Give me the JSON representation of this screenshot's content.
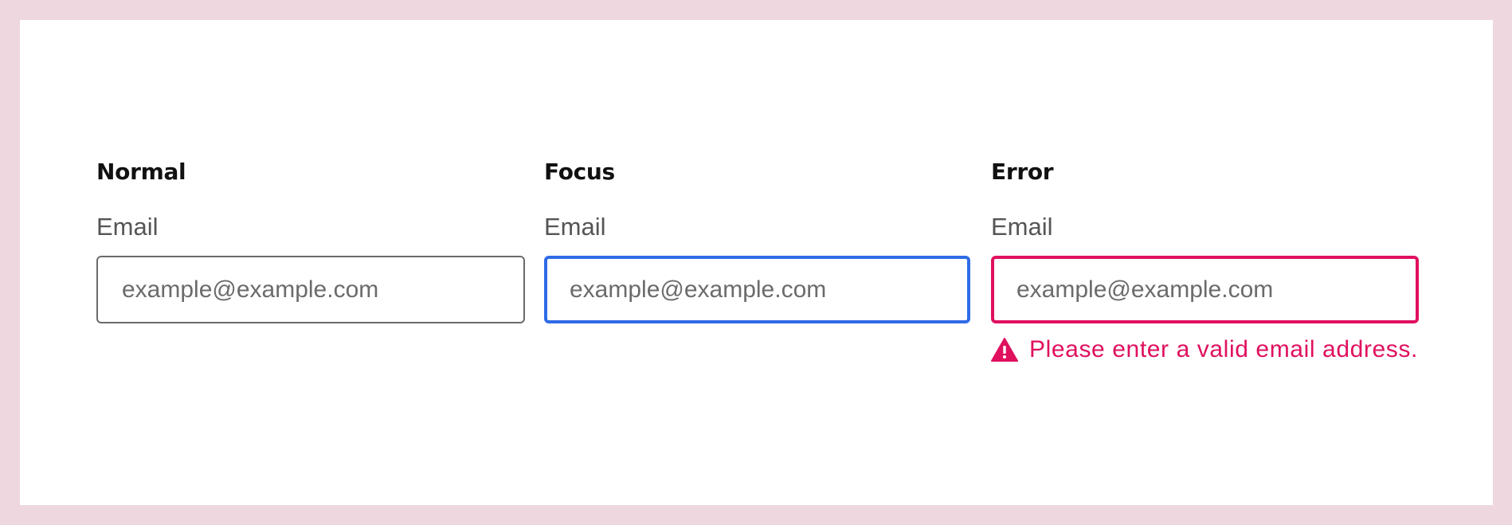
{
  "states": [
    {
      "key": "normal",
      "title": "Normal",
      "label": "Email",
      "placeholder": "example@example.com",
      "border_color": "#6b6b6b"
    },
    {
      "key": "focus",
      "title": "Focus",
      "label": "Email",
      "placeholder": "example@example.com",
      "border_color": "#2f6be6"
    },
    {
      "key": "error",
      "title": "Error",
      "label": "Email",
      "placeholder": "example@example.com",
      "border_color": "#e0105f",
      "error_message": "Please enter a valid email address.",
      "error_icon": "warning-triangle-icon"
    }
  ],
  "colors": {
    "outer_background": "#efd7df",
    "panel_background": "#ffffff",
    "error": "#e0105f",
    "focus": "#2f6be6"
  }
}
